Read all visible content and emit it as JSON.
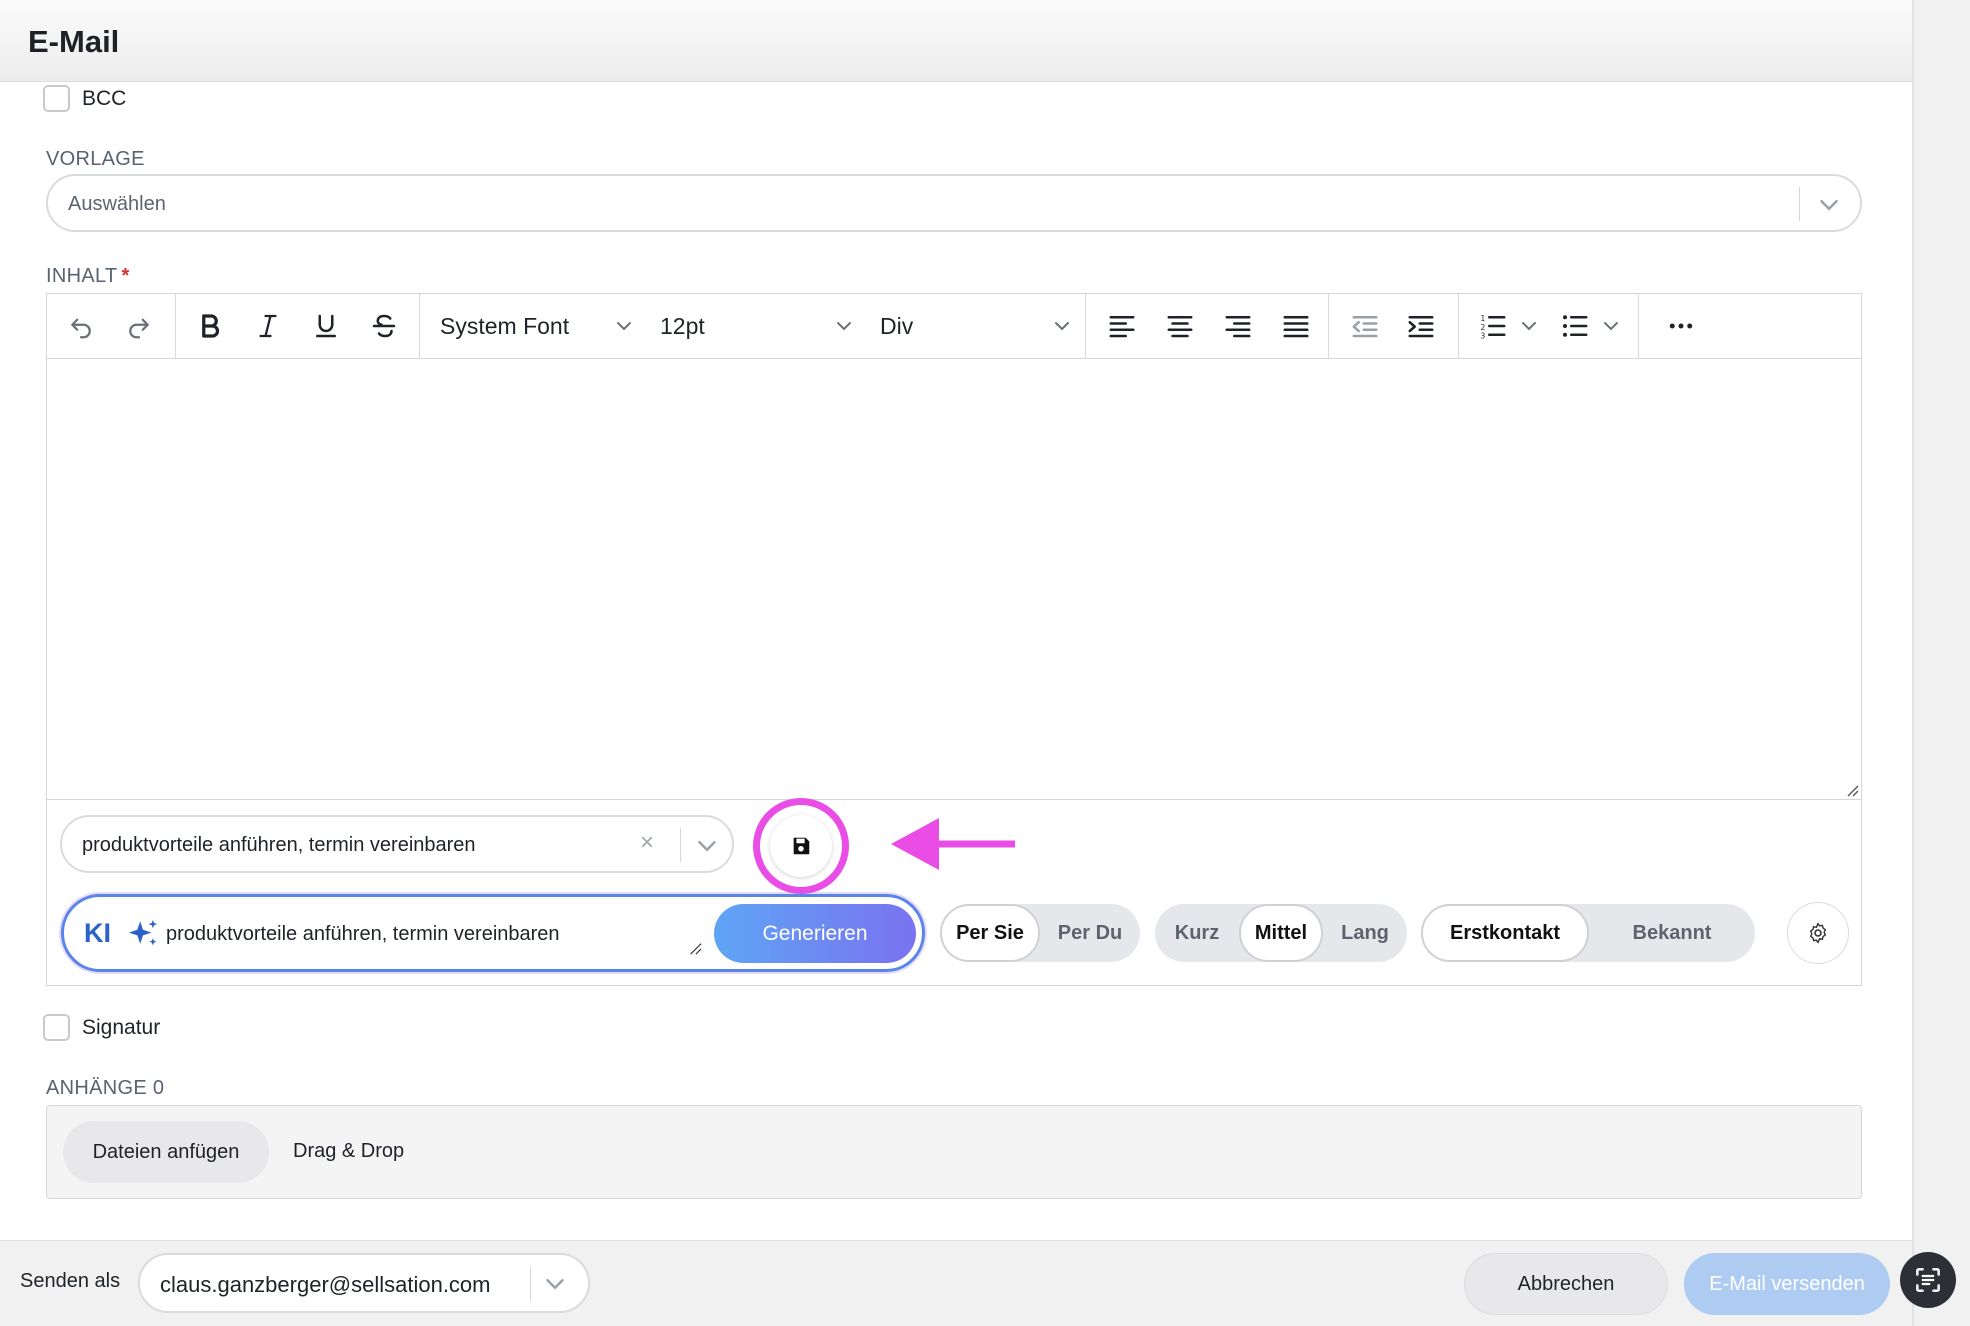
{
  "header": {
    "title": "E-Mail"
  },
  "bcc": {
    "label": "BCC",
    "checked": false
  },
  "template": {
    "label": "VORLAGE",
    "placeholder": "Auswählen"
  },
  "content": {
    "label": "INHALT",
    "required_mark": "*",
    "toolbar": {
      "font": "System Font",
      "size": "12pt",
      "block": "Div"
    }
  },
  "prompt_preset": {
    "value": "produktvorteile anführen, termin vereinbaren",
    "clear_glyph": "×"
  },
  "ai": {
    "label": "KI",
    "prompt": "produktvorteile anführen, termin vereinbaren",
    "generate_label": "Generieren",
    "address": {
      "options": [
        "Per Sie",
        "Per Du"
      ],
      "selected": "Per Sie"
    },
    "length": {
      "options": [
        "Kurz",
        "Mittel",
        "Lang"
      ],
      "selected": "Mittel"
    },
    "relation": {
      "options": [
        "Erstkontakt",
        "Bekannt"
      ],
      "selected": "Erstkontakt"
    },
    "accent_colors": {
      "border": "#5a84e8",
      "gradient_start": "#5ea5f4",
      "gradient_end": "#7a72f0"
    }
  },
  "signature": {
    "label": "Signatur",
    "checked": false
  },
  "attachments": {
    "label": "ANHÄNGE 0",
    "add_label": "Dateien anfügen",
    "dnd_label": "Drag & Drop"
  },
  "footer": {
    "send_as_label": "Senden als",
    "from": "claus.ganzberger@sellsation.com",
    "cancel_label": "Abbrechen",
    "send_label": "E-Mail versenden"
  },
  "annotation": {
    "highlight_color": "#e94de6"
  }
}
